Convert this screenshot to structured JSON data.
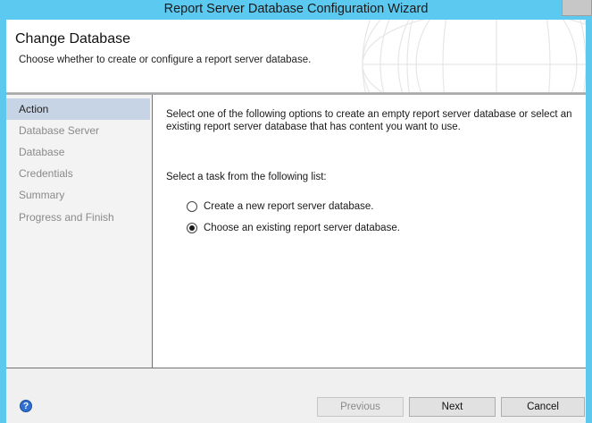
{
  "window": {
    "title": "Report Server Database Configuration Wizard"
  },
  "header": {
    "title": "Change Database",
    "subtitle": "Choose whether to create or configure a report server database."
  },
  "sidebar": {
    "items": [
      {
        "label": "Action",
        "active": true
      },
      {
        "label": "Database Server",
        "active": false
      },
      {
        "label": "Database",
        "active": false
      },
      {
        "label": "Credentials",
        "active": false
      },
      {
        "label": "Summary",
        "active": false
      },
      {
        "label": "Progress and Finish",
        "active": false
      }
    ]
  },
  "main": {
    "intro": "Select one of the following options to create an empty report server database or select an existing report server database that has content you want to use.",
    "task_label": "Select a task from the following list:",
    "options": [
      {
        "label": "Create a new report server database.",
        "selected": false
      },
      {
        "label": "Choose an existing report server database.",
        "selected": true
      }
    ]
  },
  "footer": {
    "help_icon": "help-icon",
    "previous_label": "Previous",
    "next_label": "Next",
    "cancel_label": "Cancel"
  },
  "colors": {
    "titlebar": "#5bc9f0",
    "sidebar_active": "#c7d4e6"
  }
}
